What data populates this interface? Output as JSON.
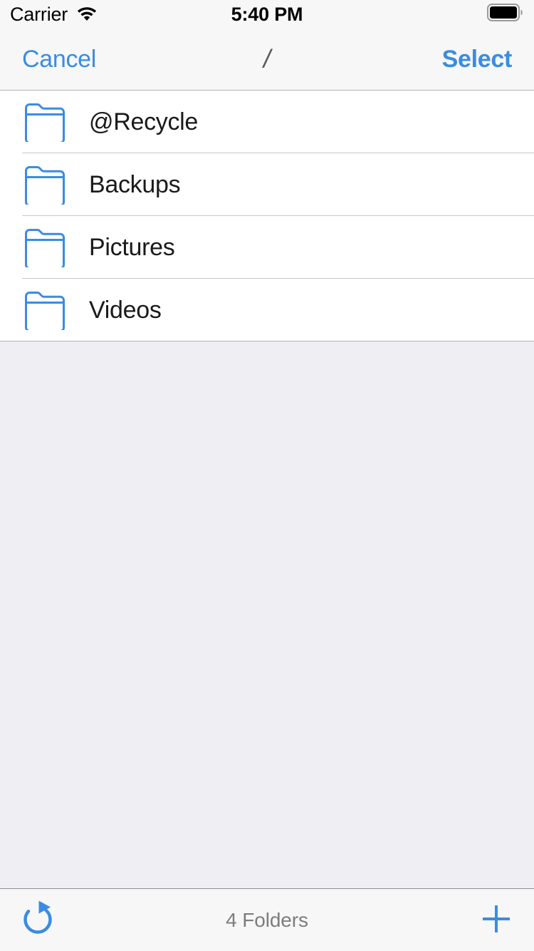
{
  "status_bar": {
    "carrier": "Carrier",
    "wifi_icon": "wifi-icon",
    "time": "5:40 PM",
    "battery_icon": "battery-full-icon"
  },
  "nav_bar": {
    "cancel_label": "Cancel",
    "title": "/",
    "select_label": "Select"
  },
  "list": {
    "rows": [
      {
        "icon": "folder-icon",
        "name": "@Recycle"
      },
      {
        "icon": "folder-icon",
        "name": "Backups"
      },
      {
        "icon": "folder-icon",
        "name": "Pictures"
      },
      {
        "icon": "folder-icon",
        "name": "Videos"
      }
    ]
  },
  "toolbar": {
    "refresh_icon": "refresh-icon",
    "status_text": "4 Folders",
    "add_icon": "plus-icon"
  },
  "colors": {
    "accent_blue": "#3a8ce2",
    "folder_blue": "#3a8ce2",
    "background_gray": "#efeef3",
    "bar_gray": "#f7f7f7",
    "text_primary": "#1a1a1a",
    "text_secondary": "#7d7d7d",
    "title_gray": "#5a5a5a",
    "separator": "#c8c7cc"
  }
}
